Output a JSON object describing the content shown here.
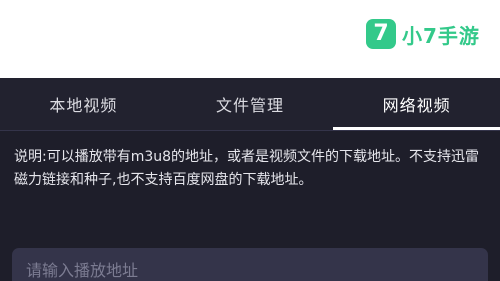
{
  "watermark": {
    "logo_glyph": "7",
    "brand_text": "小7手游",
    "brand_color": "#33c98a"
  },
  "tabs": [
    {
      "label": "本地视频",
      "active": false
    },
    {
      "label": "文件管理",
      "active": false
    },
    {
      "label": "网络视频",
      "active": true
    }
  ],
  "description": "说明:可以播放带有m3u8的地址，或者是视频文件的下载地址。不支持迅雷磁力链接和种子,也不支持百度网盘的下载地址。",
  "url_input": {
    "placeholder": "请输入播放地址",
    "value": ""
  },
  "colors": {
    "panel_background": "#1e1e2a",
    "tab_bar_background": "#22222f",
    "input_background": "#34344a",
    "active_indicator": "#ffffff"
  }
}
